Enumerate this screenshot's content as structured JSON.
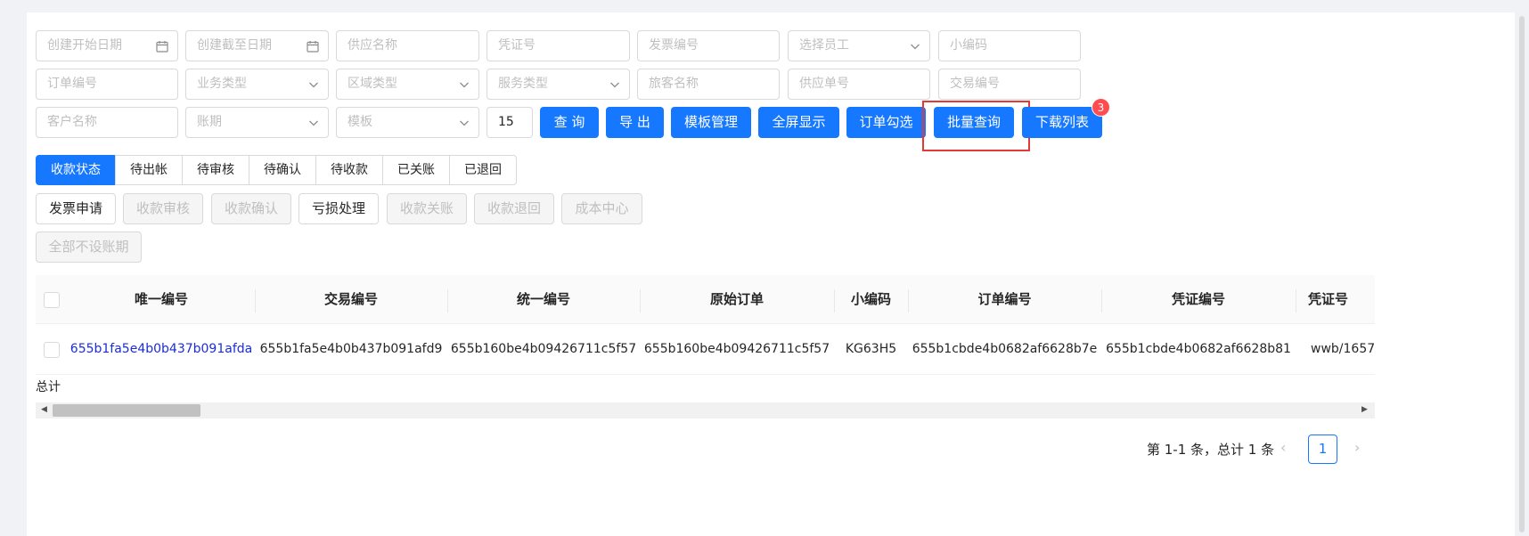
{
  "filters": {
    "row1": [
      {
        "placeholder": "创建开始日期",
        "icon": "calendar-icon"
      },
      {
        "placeholder": "创建截至日期",
        "icon": "calendar-icon"
      },
      {
        "placeholder": "供应名称"
      },
      {
        "placeholder": "凭证号"
      },
      {
        "placeholder": "发票编号"
      },
      {
        "placeholder": "选择员工",
        "icon": "chevron-down-icon"
      },
      {
        "placeholder": "小编码"
      }
    ],
    "row2": [
      {
        "placeholder": "订单编号"
      },
      {
        "placeholder": "业务类型",
        "icon": "chevron-down-icon"
      },
      {
        "placeholder": "区域类型",
        "icon": "chevron-down-icon"
      },
      {
        "placeholder": "服务类型",
        "icon": "chevron-down-icon"
      },
      {
        "placeholder": "旅客名称"
      },
      {
        "placeholder": "供应单号"
      },
      {
        "placeholder": "交易编号"
      }
    ],
    "row3": [
      {
        "placeholder": "客户名称"
      },
      {
        "placeholder": "账期",
        "icon": "chevron-down-icon"
      },
      {
        "placeholder": "模板",
        "icon": "chevron-down-icon"
      }
    ],
    "page_size": "15"
  },
  "toolbar": {
    "query": "查 询",
    "export": "导 出",
    "template_manage": "模板管理",
    "fullscreen": "全屏显示",
    "order_select": "订单勾选",
    "batch_query": "批量查询",
    "download_list": "下载列表",
    "download_badge": "3"
  },
  "status_tabs": [
    "收款状态",
    "待出帐",
    "待审核",
    "待确认",
    "待收款",
    "已关账",
    "已退回"
  ],
  "actions": {
    "invoice_apply": "发票申请",
    "receipt_review": "收款审核",
    "receipt_confirm": "收款确认",
    "loss_handle": "亏损处理",
    "receipt_close": "收款关账",
    "receipt_return": "收款退回",
    "cost_center": "成本中心",
    "no_period_all": "全部不设账期"
  },
  "table": {
    "columns": [
      "唯一编号",
      "交易编号",
      "统一编号",
      "原始订单",
      "小编码",
      "订单编号",
      "凭证编号",
      "凭证号"
    ],
    "rows": [
      [
        "655b1fa5e4b0b437b091afda",
        "655b1fa5e4b0b437b091afd9",
        "655b160be4b09426711c5f57",
        "655b160be4b09426711c5f57",
        "KG63H5",
        "655b1cbde4b0682af6628b7e",
        "655b1cbde4b0682af6628b81",
        "wwb/1657"
      ]
    ],
    "total_label": "总计"
  },
  "pagination": {
    "summary": "第 1-1 条，总计 1 条",
    "current": "1"
  },
  "colors": {
    "primary": "#1677ff",
    "link": "#1b2dd6",
    "badge": "#ff4d4f",
    "highlight": "#e53935"
  }
}
